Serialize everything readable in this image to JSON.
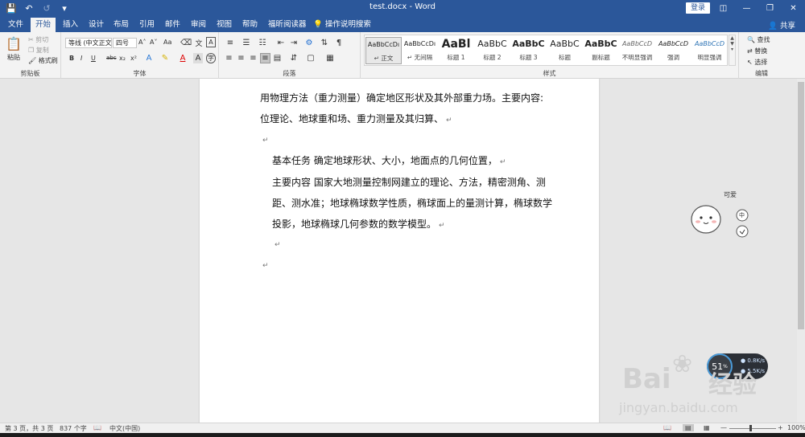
{
  "titlebar": {
    "title": "test.docx - Word",
    "login": "登录"
  },
  "tabs": [
    "文件",
    "开始",
    "插入",
    "设计",
    "布局",
    "引用",
    "邮件",
    "审阅",
    "视图",
    "帮助",
    "福昕阅读器",
    "操作说明搜索"
  ],
  "share": "共享",
  "ribbon": {
    "clipboard": {
      "label": "剪贴板",
      "paste": "粘贴",
      "cut": "剪切",
      "copy": "复制",
      "format_painter": "格式刷"
    },
    "font": {
      "label": "字体",
      "font_name": "等线 (中文正文)",
      "font_size": "四号",
      "grow": "A˄",
      "shrink": "A˅",
      "case": "Aa",
      "bold": "B",
      "italic": "I",
      "underline": "U",
      "strike": "abc",
      "sub": "x₂",
      "sup": "x²"
    },
    "paragraph": {
      "label": "段落"
    },
    "styles": {
      "label": "样式",
      "items": [
        {
          "preview": "AaBbCcDı",
          "name": "↵ 正文"
        },
        {
          "preview": "AaBbCcDı",
          "name": "↵ 无间隔"
        },
        {
          "preview": "AaBl",
          "name": "标题 1"
        },
        {
          "preview": "AaBbC",
          "name": "标题 2"
        },
        {
          "preview": "AaBbC",
          "name": "标题 3"
        },
        {
          "preview": "AaBbC",
          "name": "标题"
        },
        {
          "preview": "AaBbC",
          "name": "副标题"
        },
        {
          "preview": "AaBbCcD",
          "name": "不明显强调"
        },
        {
          "preview": "AaBbCcD",
          "name": "强调"
        },
        {
          "preview": "AaBbCcD",
          "name": "明显强调"
        }
      ]
    },
    "editing": {
      "label": "编辑",
      "find": "查找",
      "replace": "替换",
      "select": "选择"
    }
  },
  "document": {
    "paragraphs": [
      "用物理方法（重力测量）确定地区形状及其外部重力场。主要内容:",
      "位理论、地球重和场、重力测量及其归算、",
      "",
      "基本任务   确定地球形状、大小，地面点的几何位置，",
      "主要内容  国家大地测量控制网建立的理论、方法，精密测角、测",
      "距、测水准；地球椭球数学性质，椭球面上的量测计算，椭球数学",
      "投影，地球椭球几何参数的数学模型。",
      "",
      ""
    ],
    "para_mark": "↵"
  },
  "sticker": {
    "text": "可爱",
    "btn1": "中"
  },
  "speed": {
    "percent": "51",
    "unit": "%",
    "up": "0.8",
    "up_unit": "K/s",
    "down": "5.5",
    "down_unit": "K/s"
  },
  "watermark": {
    "brand": "Bai",
    "brand2": "经验",
    "url": "jingyan.baidu.com"
  },
  "statusbar": {
    "page": "第 3 页，共 3 页",
    "words": "837 个字",
    "lang": "中文(中国)",
    "zoom": "100%"
  },
  "colors": {
    "accent": "#2b579a"
  }
}
